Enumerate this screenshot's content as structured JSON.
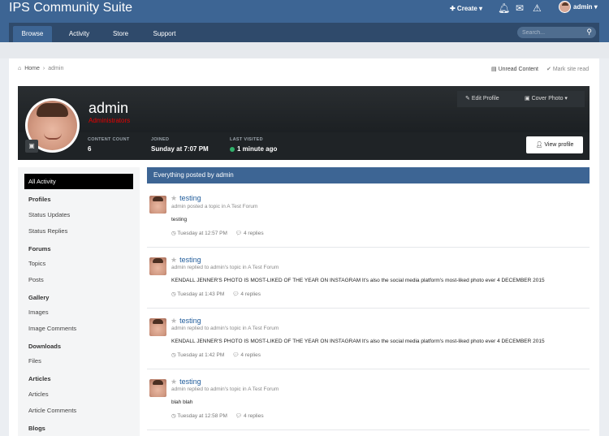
{
  "header": {
    "site_title": "IPS Community Suite",
    "create_label": "✚ Create ▾",
    "user_label": "admin ▾"
  },
  "nav": {
    "tabs": [
      "Browse",
      "Activity",
      "Store",
      "Support"
    ],
    "active_tab": "Browse",
    "search_placeholder": "Search..."
  },
  "breadcrumb": {
    "home": "Home",
    "current": "admin",
    "unread": "Unread Content",
    "mark_read": "Mark site read"
  },
  "profile": {
    "name": "admin",
    "group": "Administrators",
    "edit_profile": "Edit Profile",
    "cover_photo": "Cover Photo ▾",
    "view_profile": "View profile",
    "stats": [
      {
        "label": "CONTENT COUNT",
        "value": "6"
      },
      {
        "label": "JOINED",
        "value": "Sunday at 7:07 PM"
      },
      {
        "label": "LAST VISITED",
        "value": "1 minute ago"
      }
    ]
  },
  "sidebar": {
    "active": "All Activity",
    "sections": [
      {
        "head": "Profiles",
        "items": [
          "Status Updates",
          "Status Replies"
        ]
      },
      {
        "head": "Forums",
        "items": [
          "Topics",
          "Posts"
        ]
      },
      {
        "head": "Gallery",
        "items": [
          "Images",
          "Image Comments"
        ]
      },
      {
        "head": "Downloads",
        "items": [
          "Files"
        ]
      },
      {
        "head": "Articles",
        "items": [
          "Articles",
          "Article Comments"
        ]
      },
      {
        "head": "Blogs",
        "items": []
      }
    ]
  },
  "stream": {
    "header": "Everything posted by admin",
    "entries": [
      {
        "title": "testing",
        "meta": "admin posted a topic in A Test Forum",
        "body": "testing",
        "time": "Tuesday at 12:57 PM",
        "replies": "4 replies"
      },
      {
        "title": "testing",
        "meta": "admin replied to admin's topic in A Test Forum",
        "body": "KENDALL JENNER'S PHOTO IS MOST-LIKED OF THE YEAR ON INSTAGRAM It's also the social media platform's most-liked photo ever 4 DECEMBER 2015",
        "time": "Tuesday at 1:43 PM",
        "replies": "4 replies"
      },
      {
        "title": "testing",
        "meta": "admin replied to admin's topic in A Test Forum",
        "body": "KENDALL JENNER'S PHOTO IS MOST-LIKED OF THE YEAR ON INSTAGRAM It's also the social media platform's most-liked photo ever 4 DECEMBER 2015",
        "time": "Tuesday at 1:42 PM",
        "replies": "4 replies"
      },
      {
        "title": "testing",
        "meta": "admin replied to admin's topic in A Test Forum",
        "body": "blah blah",
        "time": "Tuesday at 12:58 PM",
        "replies": "4 replies"
      }
    ]
  }
}
